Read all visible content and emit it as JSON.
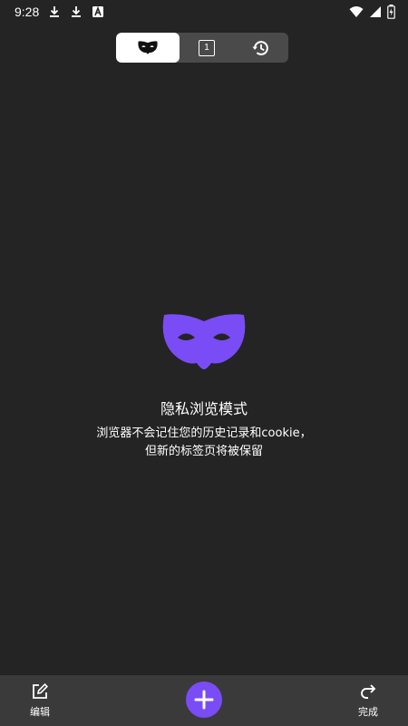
{
  "status_bar": {
    "time": "9:28",
    "icons": [
      "download-icon",
      "download-icon",
      "text-a-icon"
    ],
    "right_icons": [
      "wifi-icon",
      "signal-icon",
      "battery-icon"
    ]
  },
  "tab_switcher": {
    "tabs": [
      {
        "name": "incognito",
        "icon": "mask-icon",
        "active": true
      },
      {
        "name": "tabs",
        "icon": "tab-count-icon",
        "count": "1",
        "active": false
      },
      {
        "name": "history",
        "icon": "history-icon",
        "active": false
      }
    ]
  },
  "main": {
    "title": "隐私浏览模式",
    "description_line1": "浏览器不会记住您的历史记录和cookie，",
    "description_line2": "但新的标签页将被保留"
  },
  "bottom_bar": {
    "edit_label": "编辑",
    "done_label": "完成"
  },
  "colors": {
    "background": "#242424",
    "accent": "#7a4cf5",
    "bottom_bar": "#3a3a3a",
    "tab_switcher": "#4a4a4a"
  }
}
